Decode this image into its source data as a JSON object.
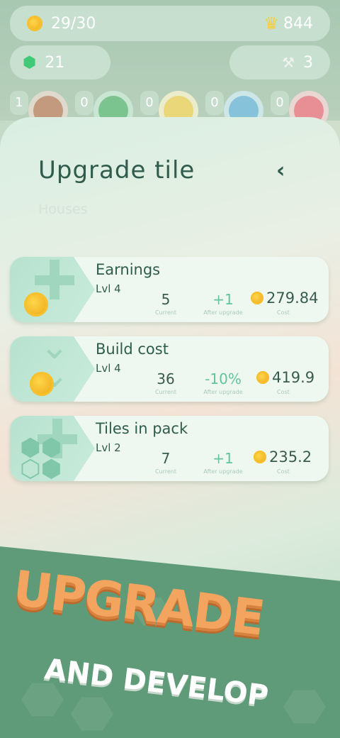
{
  "header": {
    "tiles": "29/30",
    "crowns": "844",
    "gems": "21",
    "tools": "3"
  },
  "sectors": [
    {
      "count": "1",
      "color": "#c49a7f"
    },
    {
      "count": "0",
      "color": "#7bc38f"
    },
    {
      "count": "0",
      "color": "#e9d779"
    },
    {
      "count": "0",
      "color": "#86c2d9"
    },
    {
      "count": "0",
      "color": "#e78f94"
    }
  ],
  "panel": {
    "title": "Upgrade tile",
    "subtitle": "Houses"
  },
  "upgrades": [
    {
      "name": "Earnings",
      "level": "Lvl 4",
      "current": "5",
      "current_label": "Current",
      "after": "+1",
      "after_label": "After upgrade",
      "cost": "279.84",
      "cost_label": "Cost"
    },
    {
      "name": "Build cost",
      "level": "Lvl 4",
      "current": "36",
      "current_label": "Current",
      "after": "-10%",
      "after_label": "After upgrade",
      "cost": "419.9",
      "cost_label": "Cost"
    },
    {
      "name": "Tiles in pack",
      "level": "Lvl 2",
      "current": "7",
      "current_label": "Current",
      "after": "+1",
      "after_label": "After upgrade",
      "cost": "235.2",
      "cost_label": "Cost"
    }
  ],
  "banner": {
    "line1": "UPGRADE",
    "line2": "AND DEVELOP"
  },
  "colors": {
    "accent_green": "#61c49b",
    "title_green": "#2f5c4c",
    "banner_orange": "#f3a45f"
  }
}
